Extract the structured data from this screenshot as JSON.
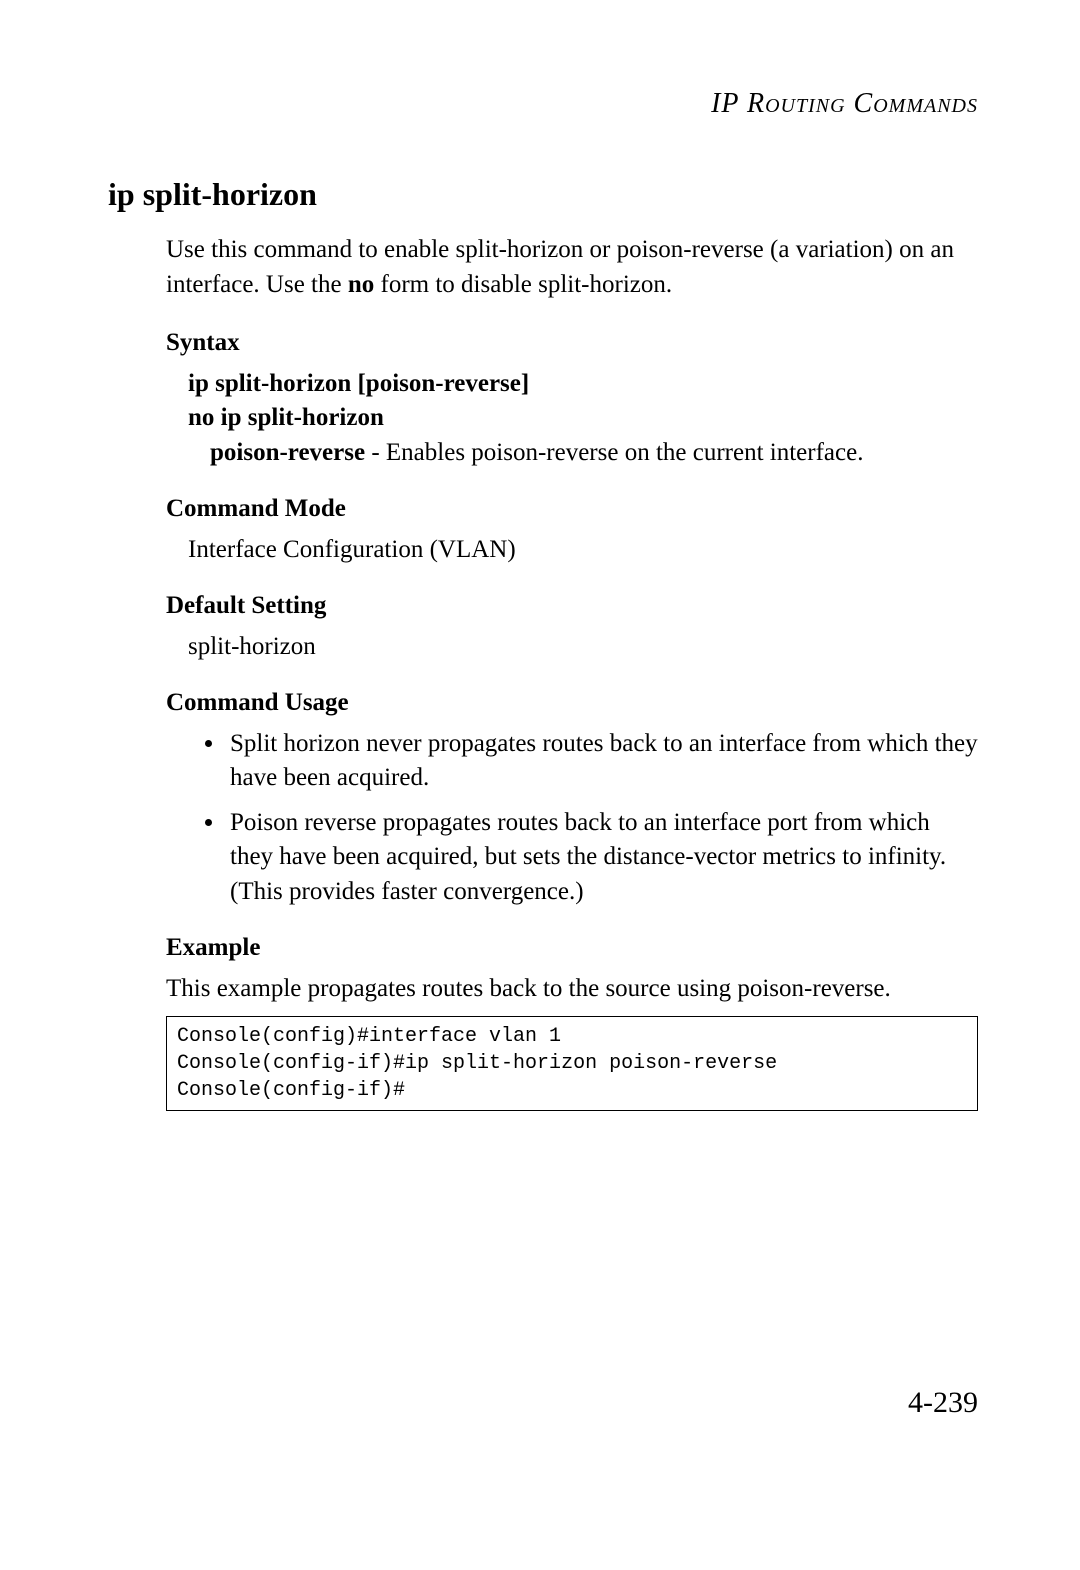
{
  "running_head": "IP Routing Commands",
  "title": "ip split-horizon",
  "intro_part1": "Use this command to enable split-horizon or poison-reverse (a variation) on an interface. Use the ",
  "intro_bold": "no",
  "intro_part2": " form to disable split-horizon.",
  "syntax_label": "Syntax",
  "syntax_line1": "ip split-horizon [poison-reverse]",
  "syntax_line2": "no ip split-horizon",
  "syntax_param_bold": "poison-reverse",
  "syntax_param_rest": " - Enables poison-reverse on the current interface.",
  "cmdmode_label": "Command Mode",
  "cmdmode_value": "Interface Configuration (VLAN)",
  "default_label": "Default Setting",
  "default_value": "split-horizon",
  "usage_label": "Command Usage",
  "usage_items": [
    "Split horizon never propagates routes back to an interface from which they have been acquired.",
    "Poison reverse propagates routes back to an interface port from which they have been acquired, but sets the distance-vector metrics to infinity. (This provides faster convergence.)"
  ],
  "example_label": "Example",
  "example_intro": "This example propagates routes back to the source using poison-reverse.",
  "example_code": "Console(config)#interface vlan 1\nConsole(config-if)#ip split-horizon poison-reverse\nConsole(config-if)#",
  "page_number": "4-239"
}
